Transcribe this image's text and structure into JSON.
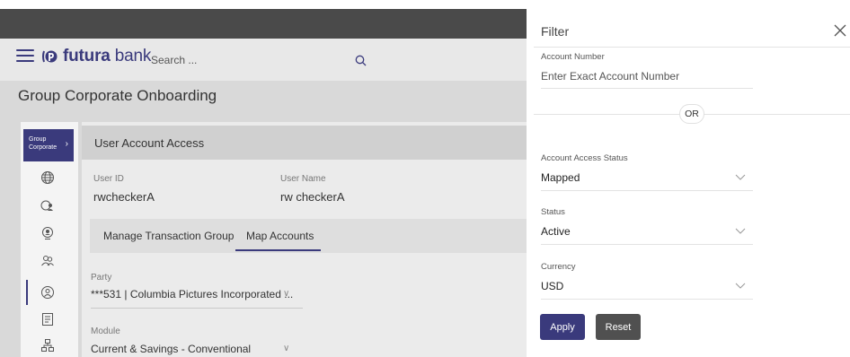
{
  "header": {
    "brand_bold": "futura",
    "brand_rest": " bank",
    "search_placeholder": "Search ..."
  },
  "page_title": "Group Corporate Onboarding",
  "sidenav": {
    "active_line1": "Group",
    "active_line2": "Corporate",
    "icons": [
      "globe-icon",
      "users-globe-icon",
      "user-badge-icon",
      "users-group-icon",
      "user-settings-icon",
      "document-list-icon",
      "network-icon"
    ]
  },
  "card": {
    "title": "User Account Access",
    "user_id_label": "User ID",
    "user_id_value": "rwcheckerA",
    "user_name_label": "User Name",
    "user_name_value": "rw checkerA",
    "tabs": [
      {
        "label": "Manage Transaction Group"
      },
      {
        "label": "Map Accounts"
      }
    ],
    "party_label": "Party",
    "party_value": "***531 | Columbia Pictures Incorporated ...",
    "module_label": "Module",
    "module_value": "Current & Savings - Conventional"
  },
  "filter": {
    "title": "Filter",
    "account_number_label": "Account Number",
    "account_number_placeholder": "Enter Exact Account Number",
    "or_text": "OR",
    "access_status_label": "Account Access Status",
    "access_status_value": "Mapped",
    "status_label": "Status",
    "status_value": "Active",
    "currency_label": "Currency",
    "currency_value": "USD",
    "apply_label": "Apply",
    "reset_label": "Reset"
  },
  "colors": {
    "accent": "#3a3a7c",
    "reset_button": "#505050"
  }
}
